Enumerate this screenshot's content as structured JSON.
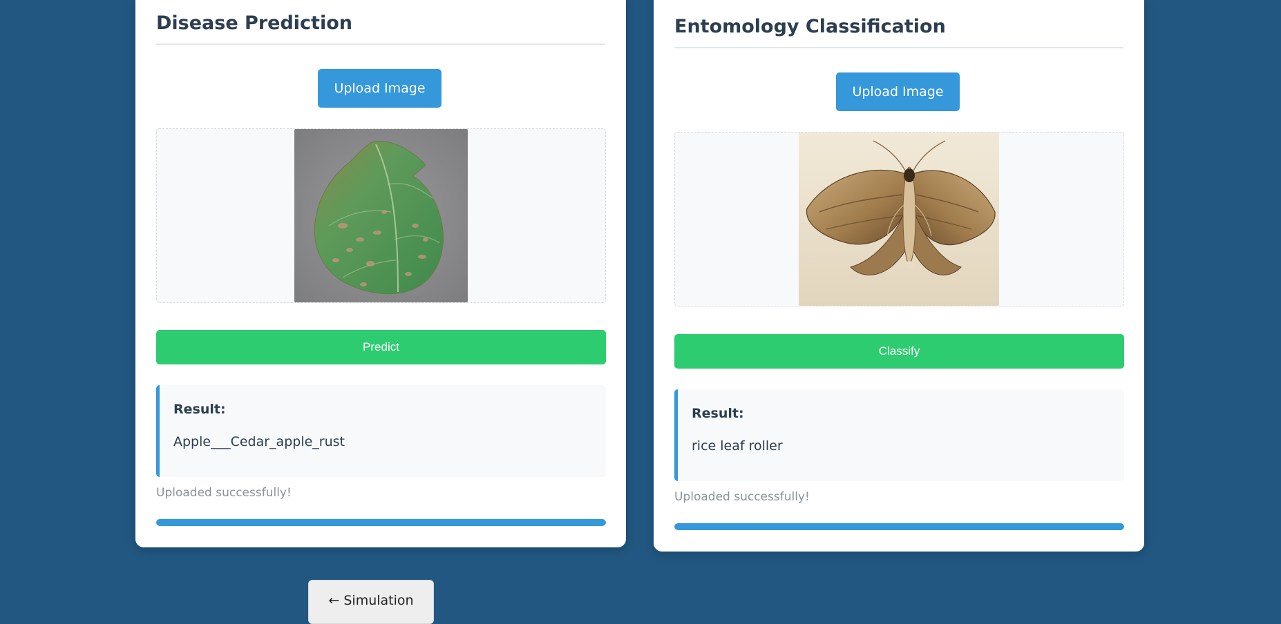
{
  "disease_panel": {
    "title": "Disease Prediction",
    "upload_label": "Upload Image",
    "action_label": "Predict",
    "result_label": "Result:",
    "result_value": "Apple___Cedar_apple_rust",
    "status": "Uploaded successfully!",
    "progress": 1.0
  },
  "entomology_panel": {
    "title": "Entomology Classification",
    "upload_label": "Upload Image",
    "action_label": "Classify",
    "result_label": "Result:",
    "result_value": "rice leaf roller",
    "status": "Uploaded successfully!",
    "progress": 1.0
  },
  "nav": {
    "back_label": "← Simulation"
  },
  "colors": {
    "background": "#215781",
    "primary": "#3498db",
    "success": "#2ecc71",
    "text": "#2c3e50"
  }
}
